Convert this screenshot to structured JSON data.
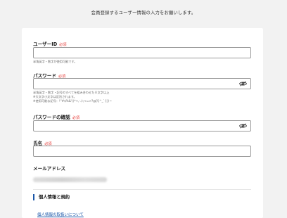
{
  "intro_text": "会員登録するユーザー情報の入力をお願いします。",
  "required_badge": "必須",
  "fields": {
    "user_id": {
      "label": "ユーザーID",
      "value": "",
      "hint": "半角英字・数字が使用可能です。"
    },
    "password": {
      "label": "パスワード",
      "value": "",
      "hint_lines": [
        "半角英字・数字・記号のすべてを組み合わせた８文字以上",
        "※大文字小文字は区別されます。",
        "※使用可能な記号：!\"#$%&'()*+,-./:;<=>?@[\\]^_`{|}~"
      ]
    },
    "password_confirm": {
      "label": "パスワードの確認",
      "value": ""
    },
    "name": {
      "label": "氏名",
      "value": ""
    },
    "email": {
      "label": "メールアドレス"
    }
  },
  "section": {
    "title": "個人情報と規約",
    "link_text": "個人情報の取扱いについて"
  },
  "colors": {
    "required": "#e53935",
    "accent": "#1a56a8",
    "background": "#f2f2f2",
    "card": "#ffffff"
  },
  "icons": {
    "password_toggle": "eye-icon",
    "password_confirm_toggle": "eye-icon"
  }
}
